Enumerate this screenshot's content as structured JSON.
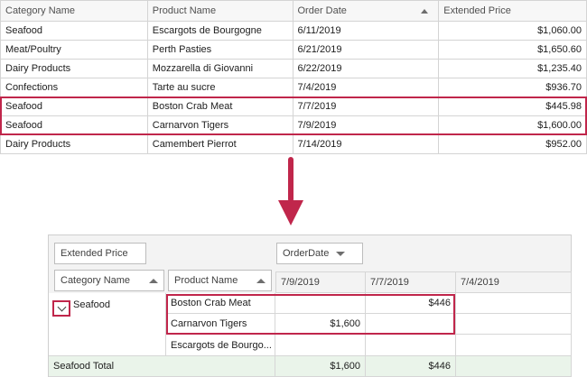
{
  "grid": {
    "columns": [
      "Category Name",
      "Product Name",
      "Order Date",
      "Extended Price"
    ],
    "rows": [
      [
        "Seafood",
        "Escargots de Bourgogne",
        "6/11/2019",
        "$1,060.00"
      ],
      [
        "Meat/Poultry",
        "Perth Pasties",
        "6/21/2019",
        "$1,650.60"
      ],
      [
        "Dairy Products",
        "Mozzarella di Giovanni",
        "6/22/2019",
        "$1,235.40"
      ],
      [
        "Confections",
        "Tarte au sucre",
        "7/4/2019",
        "$936.70"
      ],
      [
        "Seafood",
        "Boston Crab Meat",
        "7/7/2019",
        "$445.98"
      ],
      [
        "Seafood",
        "Carnarvon Tigers",
        "7/9/2019",
        "$1,600.00"
      ],
      [
        "Dairy Products",
        "Camembert Pierrot",
        "7/14/2019",
        "$952.00"
      ]
    ]
  },
  "pivot": {
    "data_field": "Extended Price",
    "column_field": "OrderDate",
    "row_fields": [
      "Category Name",
      "Product Name"
    ],
    "column_values": [
      "7/9/2019",
      "7/7/2019",
      "7/4/2019"
    ],
    "group": "Seafood",
    "products": [
      "Boston Crab Meat",
      "Carnarvon Tigers",
      "Escargots de Bourgo..."
    ],
    "cells": {
      "boston_crab_7_7": "$446",
      "carnarvon_7_9": "$1,600"
    },
    "total_label": "Seafood Total",
    "totals": [
      "$1,600",
      "$446",
      ""
    ]
  },
  "colors": {
    "accent": "#c0264b",
    "total_row": "#eaf4ea"
  },
  "icons": {
    "sort_ascending": "triangle-up",
    "filter_dropdown": "triangle-down",
    "expander": "chevron-down"
  }
}
